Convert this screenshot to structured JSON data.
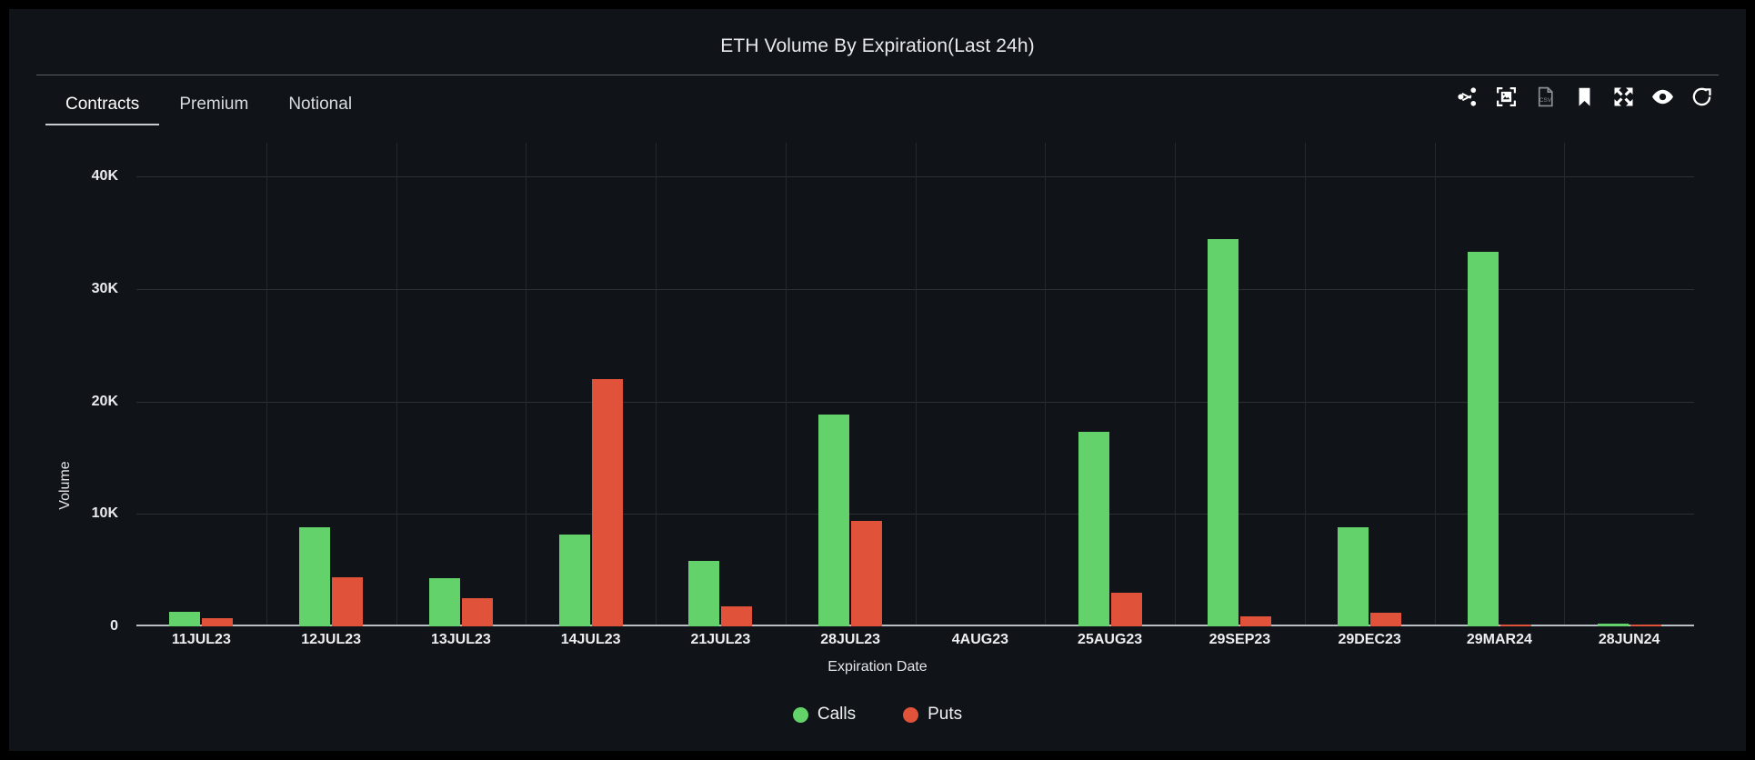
{
  "panel": {
    "title": "ETH Volume By Expiration(Last 24h)",
    "background": "#101418"
  },
  "tabs": [
    {
      "label": "Contracts",
      "active": true
    },
    {
      "label": "Premium",
      "active": false
    },
    {
      "label": "Notional",
      "active": false
    }
  ],
  "toolbar": {
    "icons": [
      {
        "name": "share-icon",
        "title": "Share"
      },
      {
        "name": "image-export-icon",
        "title": "Save image"
      },
      {
        "name": "csv-export-icon",
        "title": "Export CSV"
      },
      {
        "name": "bookmark-icon",
        "title": "Bookmark"
      },
      {
        "name": "fullscreen-icon",
        "title": "Fullscreen"
      },
      {
        "name": "eye-icon",
        "title": "Toggle visibility"
      },
      {
        "name": "refresh-icon",
        "title": "Refresh"
      }
    ]
  },
  "colors": {
    "calls": "#63d26b",
    "puts": "#e0533a",
    "grid": "#2a2f36",
    "axis": "#b9bfc7",
    "text": "#eceef0"
  },
  "watermark": "",
  "chart_data": {
    "type": "bar",
    "title": "ETH Volume By Expiration(Last 24h)",
    "subtitle": "",
    "xlabel": "Expiration Date",
    "ylabel": "Volume",
    "grid": true,
    "legend_position": "bottom",
    "ylim": [
      0,
      43000
    ],
    "yticks": [
      0,
      10000,
      20000,
      30000,
      40000
    ],
    "ytick_labels": [
      "0",
      "10K",
      "20K",
      "30K",
      "40K"
    ],
    "categories": [
      "11JUL23",
      "12JUL23",
      "13JUL23",
      "14JUL23",
      "21JUL23",
      "28JUL23",
      "4AUG23",
      "25AUG23",
      "29SEP23",
      "29DEC23",
      "29MAR24",
      "28JUN24"
    ],
    "series": [
      {
        "name": "Calls",
        "color": "#63d26b",
        "values": [
          1300,
          8800,
          4300,
          8200,
          5800,
          18800,
          0,
          17300,
          34400,
          8800,
          33300,
          250
        ]
      },
      {
        "name": "Puts",
        "color": "#e0533a",
        "values": [
          750,
          4400,
          2500,
          22000,
          1800,
          9400,
          0,
          3000,
          900,
          1200,
          120,
          100
        ]
      }
    ]
  }
}
